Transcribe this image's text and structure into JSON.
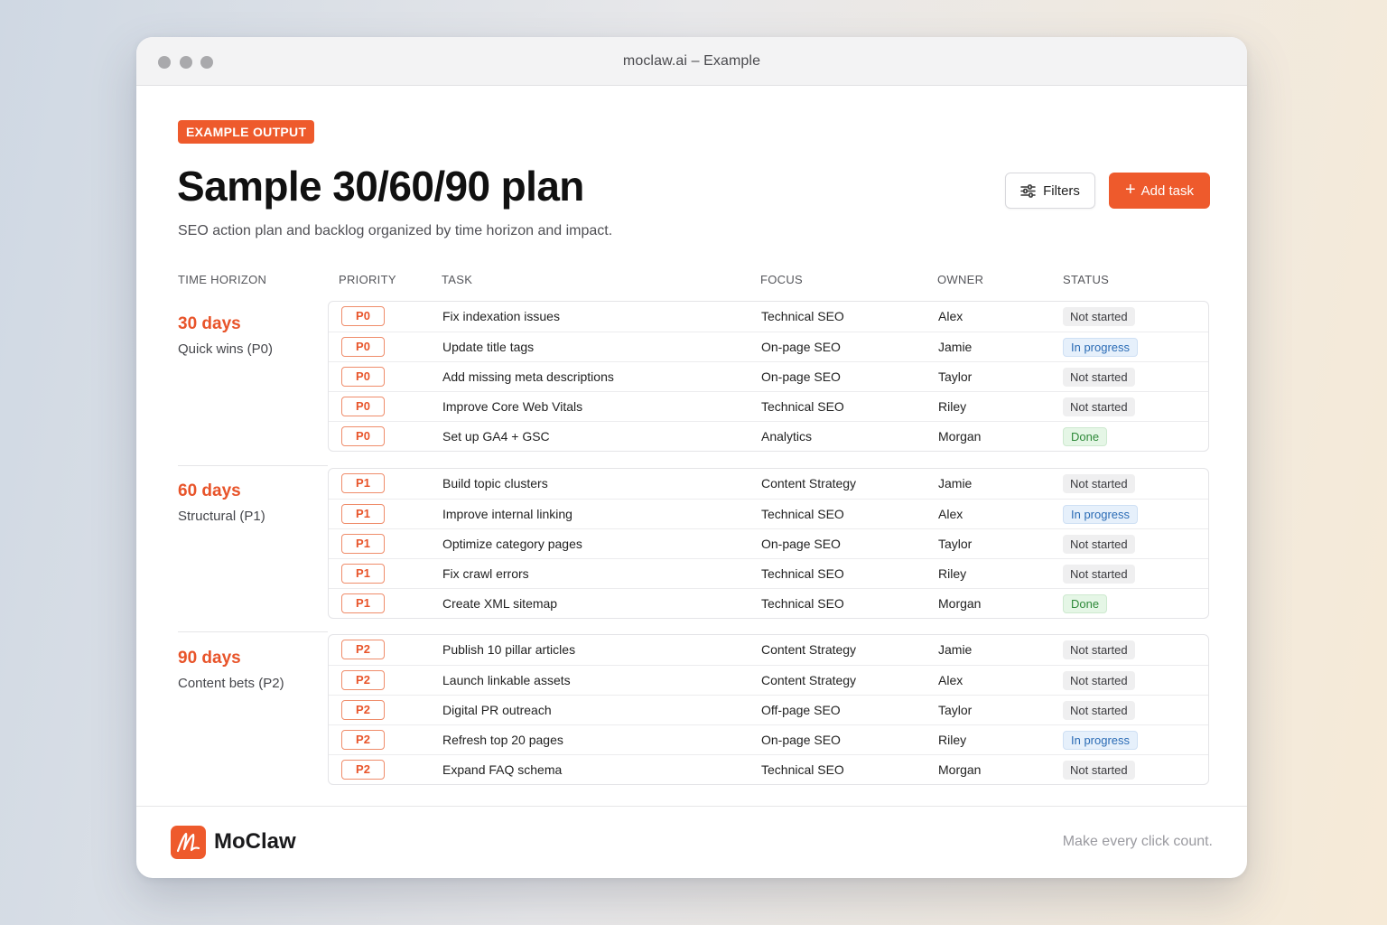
{
  "window": {
    "title": "moclaw.ai – Example"
  },
  "header": {
    "badge": "EXAMPLE OUTPUT",
    "title": "Sample 30/60/90 plan",
    "subtitle": "SEO action plan and backlog organized by time horizon and impact.",
    "filters_label": "Filters",
    "add_task_label": "Add task"
  },
  "table": {
    "columns": [
      "TIME HORIZON",
      "PRIORITY",
      "TASK",
      "FOCUS",
      "OWNER",
      "STATUS"
    ],
    "groups": [
      {
        "days": "30 days",
        "label": "Quick wins (P0)",
        "rows": [
          {
            "priority": "P0",
            "task": "Fix indexation issues",
            "focus": "Technical SEO",
            "owner": "Alex",
            "status": "Not started"
          },
          {
            "priority": "P0",
            "task": "Update title tags",
            "focus": "On-page SEO",
            "owner": "Jamie",
            "status": "In progress"
          },
          {
            "priority": "P0",
            "task": "Add missing meta descriptions",
            "focus": "On-page SEO",
            "owner": "Taylor",
            "status": "Not started"
          },
          {
            "priority": "P0",
            "task": "Improve Core Web Vitals",
            "focus": "Technical SEO",
            "owner": "Riley",
            "status": "Not started"
          },
          {
            "priority": "P0",
            "task": "Set up GA4 + GSC",
            "focus": "Analytics",
            "owner": "Morgan",
            "status": "Done"
          }
        ]
      },
      {
        "days": "60 days",
        "label": "Structural (P1)",
        "rows": [
          {
            "priority": "P1",
            "task": "Build topic clusters",
            "focus": "Content Strategy",
            "owner": "Jamie",
            "status": "Not started"
          },
          {
            "priority": "P1",
            "task": "Improve internal linking",
            "focus": "Technical SEO",
            "owner": "Alex",
            "status": "In progress"
          },
          {
            "priority": "P1",
            "task": "Optimize category pages",
            "focus": "On-page SEO",
            "owner": "Taylor",
            "status": "Not started"
          },
          {
            "priority": "P1",
            "task": "Fix crawl errors",
            "focus": "Technical SEO",
            "owner": "Riley",
            "status": "Not started"
          },
          {
            "priority": "P1",
            "task": "Create XML sitemap",
            "focus": "Technical SEO",
            "owner": "Morgan",
            "status": "Done"
          }
        ]
      },
      {
        "days": "90 days",
        "label": "Content bets (P2)",
        "rows": [
          {
            "priority": "P2",
            "task": "Publish 10 pillar articles",
            "focus": "Content Strategy",
            "owner": "Jamie",
            "status": "Not started"
          },
          {
            "priority": "P2",
            "task": "Launch linkable assets",
            "focus": "Content Strategy",
            "owner": "Alex",
            "status": "Not started"
          },
          {
            "priority": "P2",
            "task": "Digital PR outreach",
            "focus": "Off-page SEO",
            "owner": "Taylor",
            "status": "Not started"
          },
          {
            "priority": "P2",
            "task": "Refresh top 20 pages",
            "focus": "On-page SEO",
            "owner": "Riley",
            "status": "In progress"
          },
          {
            "priority": "P2",
            "task": "Expand FAQ schema",
            "focus": "Technical SEO",
            "owner": "Morgan",
            "status": "Not started"
          }
        ]
      }
    ]
  },
  "footer": {
    "brand": "MoClaw",
    "tagline": "Make every click count."
  },
  "colors": {
    "accent": "#ee5a2c",
    "in_progress": "#2a6bb5",
    "done": "#2f8a3a"
  },
  "icons": {
    "filters": "sliders-icon",
    "add": "plus-icon",
    "logo": "moclaw-logo-icon"
  }
}
